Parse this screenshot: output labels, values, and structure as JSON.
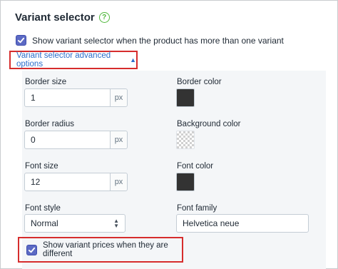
{
  "section": {
    "title": "Variant selector",
    "help_icon": "question-mark-icon"
  },
  "show_selector": {
    "checked": true,
    "label": "Show variant selector when the product has more than one variant"
  },
  "advanced_toggle": {
    "label": "Variant selector advanced options",
    "indicator": "▲"
  },
  "fields": {
    "border_size": {
      "label": "Border size",
      "value": "1",
      "unit": "px"
    },
    "border_color": {
      "label": "Border color",
      "color": "#333333"
    },
    "border_radius": {
      "label": "Border radius",
      "value": "0",
      "unit": "px"
    },
    "background_color": {
      "label": "Background color",
      "color": "transparent"
    },
    "font_size": {
      "label": "Font size",
      "value": "12",
      "unit": "px"
    },
    "font_color": {
      "label": "Font color",
      "color": "#333333"
    },
    "font_style": {
      "label": "Font style",
      "value": "Normal"
    },
    "font_family": {
      "label": "Font family",
      "value": "Helvetica neue"
    }
  },
  "show_prices": {
    "checked": true,
    "label": "Show variant prices when they are different"
  },
  "colors": {
    "accent": "#5c6ac4",
    "link": "#2c6ecb",
    "highlight_border": "#d62d2d",
    "panel_bg": "#f4f6f8"
  }
}
